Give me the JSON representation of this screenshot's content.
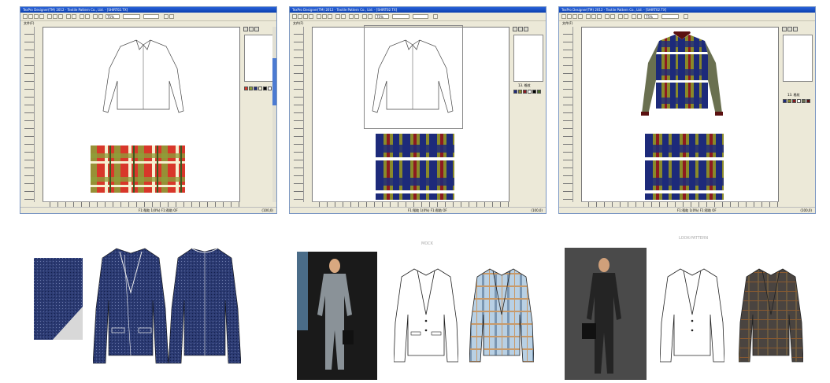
{
  "windows": [
    {
      "title": "TexPro Designer(TM) 2012 - Textile Pattern Co., Ltd. - [SHIRT02.TX]",
      "menu": "文件(F)",
      "zoom": "75%",
      "status": "F1:帮助 1(0%) F1:帮助 OF",
      "coords": "(100,0)"
    },
    {
      "title": "TexPro Designer(TM) 2012 - Textile Pattern Co., Ltd. - [SHIRT02.TX]",
      "menu": "文件(F)",
      "zoom": "75%",
      "status": "F1:帮助 1(0%) F1:帮助 OF",
      "coords": "(100,0)",
      "panel_label": "13. 格纹"
    },
    {
      "title": "TexPro Designer(TM) 2012 - Textile Pattern Co., Ltd. - [SHIRT02.TX]",
      "menu": "文件(F)",
      "zoom": "75%",
      "status": "F1:帮助 1(0%) F1:帮助 OF",
      "coords": "(100,0)",
      "panel_label": "13. 格纹"
    }
  ],
  "captions": {
    "middle": "MOCK",
    "right": "LOOK-PATTERN"
  },
  "colors": {
    "title_blue": "#0a3fb0",
    "navy": "#1d2a7a",
    "olive": "#8a8a2a",
    "red_plaid": "#d8372a",
    "green_plaid": "#8ca038",
    "sleeve_olive": "#6a7050",
    "collar_maroon": "#5a1010",
    "light_blue_plaid": "#a8c8e0"
  }
}
